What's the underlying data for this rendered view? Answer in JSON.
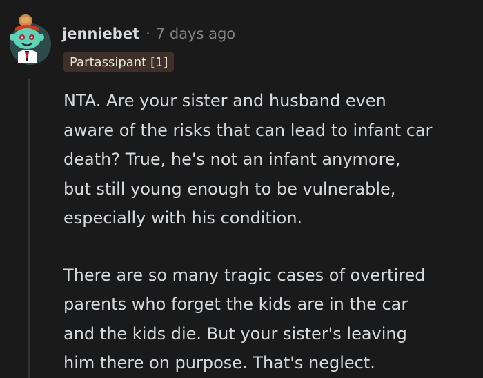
{
  "comment": {
    "username": "jenniebet",
    "separator": "·",
    "timestamp": "7 days ago",
    "flair": "Partassipant [1]",
    "avatar_icon": "snoo-avatar-icon",
    "paragraphs": [
      "NTA. Are your sister and husband even\naware of the risks that can lead to infant car\ndeath? True, he's not an infant anymore,\nbut still young enough to be vulnerable,\nespecially with his condition.",
      "There are so many tragic cases of overtired\nparents who forget the kids are in the car\nand the kids die. But your sister's leaving\nhim there on purpose. That's neglect."
    ]
  },
  "colors": {
    "background": "#1a1a1b",
    "text": "#d7dadc",
    "muted": "#818384",
    "flair_bg": "#3e3028",
    "thread_line": "#343536"
  }
}
